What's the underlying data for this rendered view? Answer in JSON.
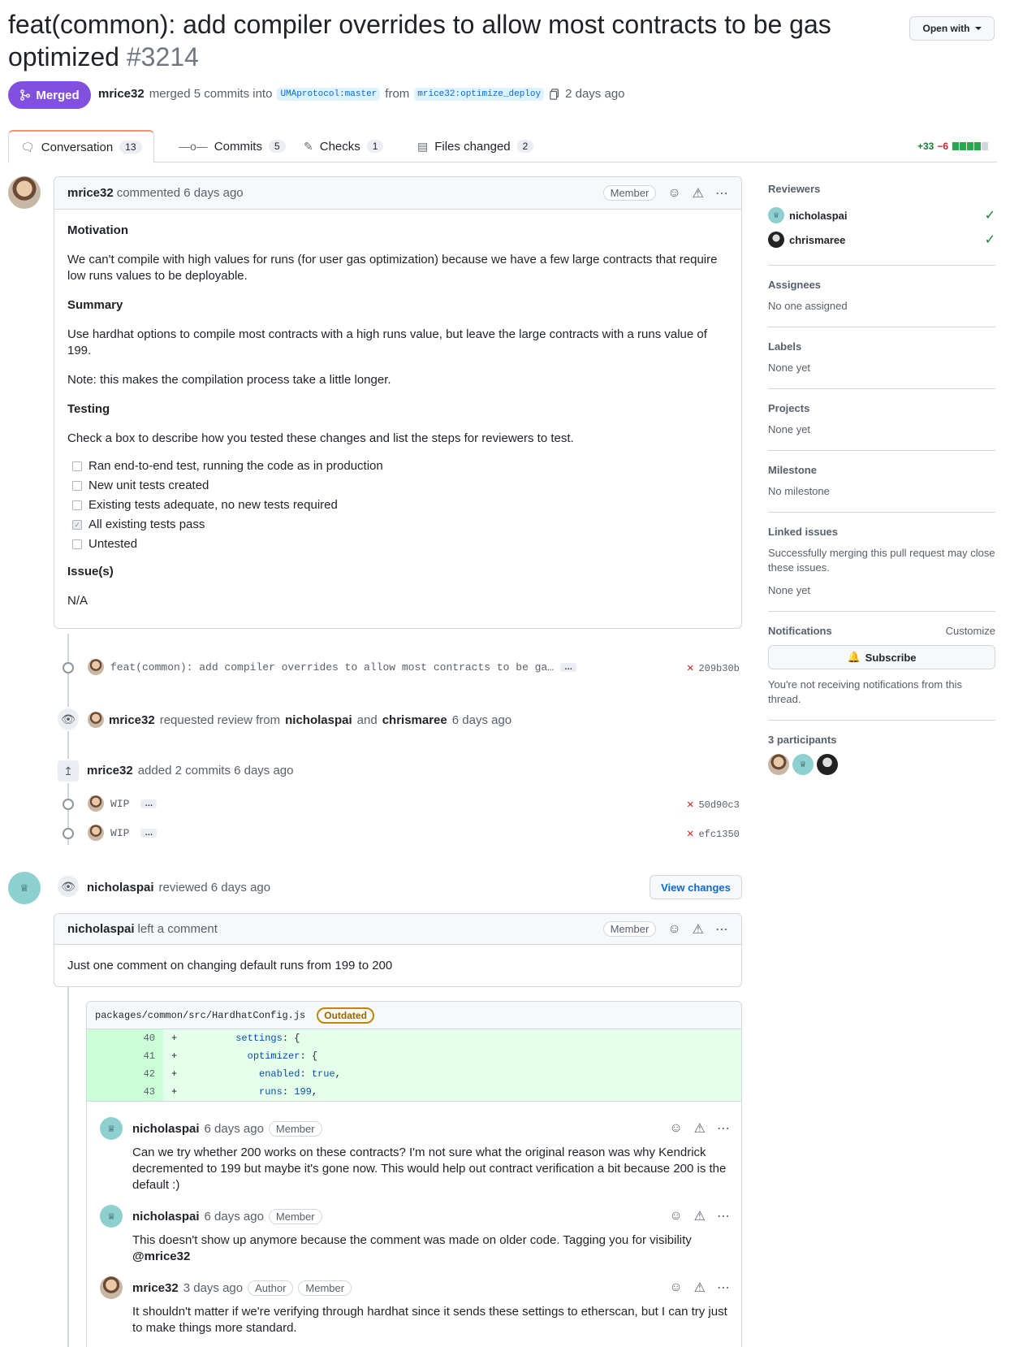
{
  "pr": {
    "title": "feat(common): add compiler overrides to allow most contracts to be gas optimized",
    "number": "#3214",
    "open_with": "Open with",
    "status": "Merged",
    "author": "mrice32",
    "merge_text": "merged 5 commits into",
    "base_branch": "UMAprotocol:master",
    "from_text": "from",
    "head_branch": "mrice32:optimize_deploy",
    "time": "2 days ago"
  },
  "tabs": [
    {
      "label": "Conversation",
      "count": "13"
    },
    {
      "label": "Commits",
      "count": "5"
    },
    {
      "label": "Checks",
      "count": "1"
    },
    {
      "label": "Files changed",
      "count": "2"
    }
  ],
  "diffstat": {
    "additions": "+33",
    "deletions": "−6"
  },
  "main_comment": {
    "author": "mrice32",
    "action": "commented 6 days ago",
    "label": "Member",
    "motivation_h": "Motivation",
    "motivation": "We can't compile with high values for runs (for user gas optimization) because we have a few large contracts that require low runs values to be deployable.",
    "summary_h": "Summary",
    "summary": "Use hardhat options to compile most contracts with a high runs value, but leave the large contracts with a runs value of 199.",
    "note": "Note: this makes the compilation process take a little longer.",
    "testing_h": "Testing",
    "testing": "Check a box to describe how you tested these changes and list the steps for reviewers to test.",
    "tasks": [
      {
        "label": "Ran end-to-end test, running the code as in production",
        "checked": false
      },
      {
        "label": "New unit tests created",
        "checked": false
      },
      {
        "label": "Existing tests adequate, no new tests required",
        "checked": false
      },
      {
        "label": "All existing tests pass",
        "checked": true
      },
      {
        "label": "Untested",
        "checked": false
      }
    ],
    "issues_h": "Issue(s)",
    "issues": "N/A"
  },
  "timeline": {
    "commit1_msg": "feat(common): add compiler overrides to allow most contracts to be ga…",
    "commit1_sha": "209b30b",
    "review_req_user": "mrice32",
    "review_req_text": "requested review from",
    "review_req_r1": "nicholaspai",
    "review_req_and": "and",
    "review_req_r2": "chrismaree",
    "review_req_time": "6 days ago",
    "added_user": "mrice32",
    "added_text": "added 2 commits 6 days ago",
    "wip1": "WIP",
    "wip1_sha": "50d90c3",
    "wip2": "WIP",
    "wip2_sha": "efc1350",
    "reviewed_user": "nicholaspai",
    "reviewed_text": "reviewed 6 days ago",
    "view_changes": "View changes"
  },
  "review_comment": {
    "author": "nicholaspai",
    "action": "left a comment",
    "label": "Member",
    "body": "Just one comment on changing default runs from 199 to 200"
  },
  "file": {
    "path": "packages/common/src/HardhatConfig.js",
    "badge": "Outdated",
    "lines": [
      {
        "num": "40",
        "sign": "+",
        "pre": "          ",
        "key": "settings",
        "rest": ": {"
      },
      {
        "num": "41",
        "sign": "+",
        "pre": "            ",
        "key": "optimizer",
        "rest": ": {"
      },
      {
        "num": "42",
        "sign": "+",
        "pre": "              ",
        "key": "enabled",
        "rest": ": ",
        "val": "true",
        "tail": ","
      },
      {
        "num": "43",
        "sign": "+",
        "pre": "              ",
        "key": "runs",
        "rest": ": ",
        "val": "199",
        "tail": ","
      }
    ]
  },
  "thread": [
    {
      "author": "nicholaspai",
      "time": "6 days ago",
      "labels": [
        "Member"
      ],
      "body": "Can we try whether 200 works on these contracts? I'm not sure what the original reason was why Kendrick decremented to 199 but maybe it's gone now. This would help out contract verification a bit because 200 is the default :)"
    },
    {
      "author": "nicholaspai",
      "time": "6 days ago",
      "labels": [
        "Member"
      ],
      "body": "This doesn't show up anymore because the comment was made on older code. Tagging you for visibility",
      "mention": "@mrice32"
    },
    {
      "author": "mrice32",
      "time": "3 days ago",
      "labels": [
        "Author",
        "Member"
      ],
      "body": "It shouldn't matter if we're verifying through hardhat since it sends these settings to etherscan, but I can try just to make things more standard."
    }
  ],
  "sidebar": {
    "reviewers_h": "Reviewers",
    "reviewers": [
      "nicholaspai",
      "chrismaree"
    ],
    "assignees_h": "Assignees",
    "assignees": "No one assigned",
    "labels_h": "Labels",
    "labels": "None yet",
    "projects_h": "Projects",
    "projects": "None yet",
    "milestone_h": "Milestone",
    "milestone": "No milestone",
    "linked_h": "Linked issues",
    "linked_desc": "Successfully merging this pull request may close these issues.",
    "linked": "None yet",
    "notif_h": "Notifications",
    "customize": "Customize",
    "subscribe": "Subscribe",
    "notif_desc": "You're not receiving notifications from this thread.",
    "participants": "3 participants"
  }
}
